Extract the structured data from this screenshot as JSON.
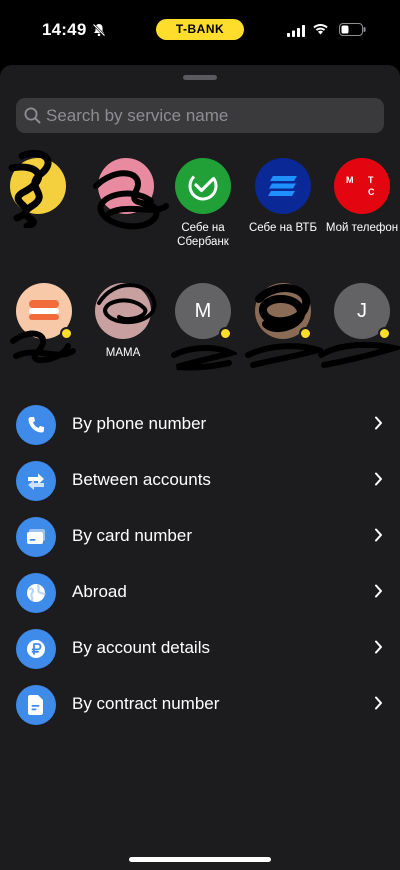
{
  "status": {
    "time": "14:49",
    "bank_badge": "T-BANK"
  },
  "search": {
    "placeholder": "Search by service name"
  },
  "shortcuts_row1": [
    {
      "label": "",
      "icon": "contact-photo",
      "color": "#f4d03f"
    },
    {
      "label": "",
      "icon": "contact-photo",
      "color": "#e88aa0"
    },
    {
      "label": "Себе на Сбербанк",
      "icon": "sberbank-logo",
      "color": "#21a038"
    },
    {
      "label": "Себе на ВТБ",
      "icon": "vtb-logo",
      "color": "#0a2896"
    },
    {
      "label": "Мой телефон",
      "icon": "mts-logo",
      "color": "#e30611"
    }
  ],
  "shortcuts_row2": [
    {
      "label": "",
      "icon": "contact-photo",
      "color": "#f7c9a9"
    },
    {
      "label": "МАМА",
      "icon": "contact-photo",
      "color": "#c9a0a0"
    },
    {
      "label": "",
      "initial": "M",
      "color": "#636366"
    },
    {
      "label": "",
      "icon": "contact-photo",
      "color": "#8a6b55"
    },
    {
      "label": "",
      "initial": "J",
      "color": "#636366"
    }
  ],
  "menu": [
    {
      "label": "By phone number",
      "icon": "phone-icon"
    },
    {
      "label": "Between accounts",
      "icon": "transfer-arrows-icon"
    },
    {
      "label": "By card number",
      "icon": "card-icon"
    },
    {
      "label": "Abroad",
      "icon": "globe-icon"
    },
    {
      "label": "By account details",
      "icon": "ruble-icon"
    },
    {
      "label": "By contract number",
      "icon": "document-icon"
    }
  ],
  "colors": {
    "accent": "#ffdd2d",
    "icon_blue": "#3f8bea",
    "sheet_bg": "#1c1c1e"
  }
}
